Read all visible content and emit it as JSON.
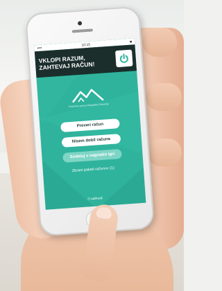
{
  "status": {
    "carrier": "•••• ",
    "time": "10:15",
    "battery": "■"
  },
  "banner": {
    "line1": "VKLOPI RAZUM,",
    "line2": "ZAHTEVAJ RAČUN!"
  },
  "logo_caption": "Finančna uprava Republike Slovenije",
  "buttons": [
    "Preveri račun",
    "Nisem dobil računa",
    "Sodeluj v nagradni igri"
  ],
  "link": "Zbrani paketi računov (1)",
  "about": "O aplikaciji",
  "icons": {
    "power": "power-icon",
    "logo": "mountains-logo-icon"
  },
  "colors": {
    "screen": "#2fb39d",
    "banner": "#1b2e2b",
    "power": "#2fb39d"
  }
}
